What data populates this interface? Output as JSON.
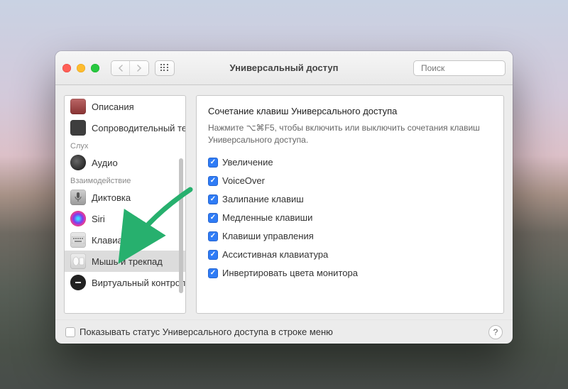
{
  "window": {
    "title": "Универсальный доступ"
  },
  "toolbar": {
    "search_placeholder": "Поиск"
  },
  "sidebar": {
    "items": [
      {
        "label": "Описания",
        "icon": "descriptions-icon"
      },
      {
        "label": "Сопроводительный текст",
        "icon": "subtitles-icon"
      }
    ],
    "section1_label": "Слух",
    "audio": {
      "label": "Аудио"
    },
    "section2_label": "Взаимодействие",
    "dictation": {
      "label": "Диктовка"
    },
    "siri": {
      "label": "Siri"
    },
    "keyboard": {
      "label": "Клавиатура"
    },
    "mouse": {
      "label": "Мышь и трекпад",
      "selected": true
    },
    "vc": {
      "label": "Виртуальный контроллер"
    }
  },
  "content": {
    "heading": "Сочетание клавиш Универсального доступа",
    "subtext": "Нажмите ⌥⌘F5, чтобы включить или выключить сочетания клавиш Универсального доступа.",
    "options": [
      "Увеличение",
      "VoiceOver",
      "Залипание клавиш",
      "Медленные клавиши",
      "Клавиши управления",
      "Ассистивная клавиатура",
      "Инвертировать цвета монитора"
    ]
  },
  "footer": {
    "show_status_label": "Показывать статус Универсального доступа в строке меню"
  }
}
